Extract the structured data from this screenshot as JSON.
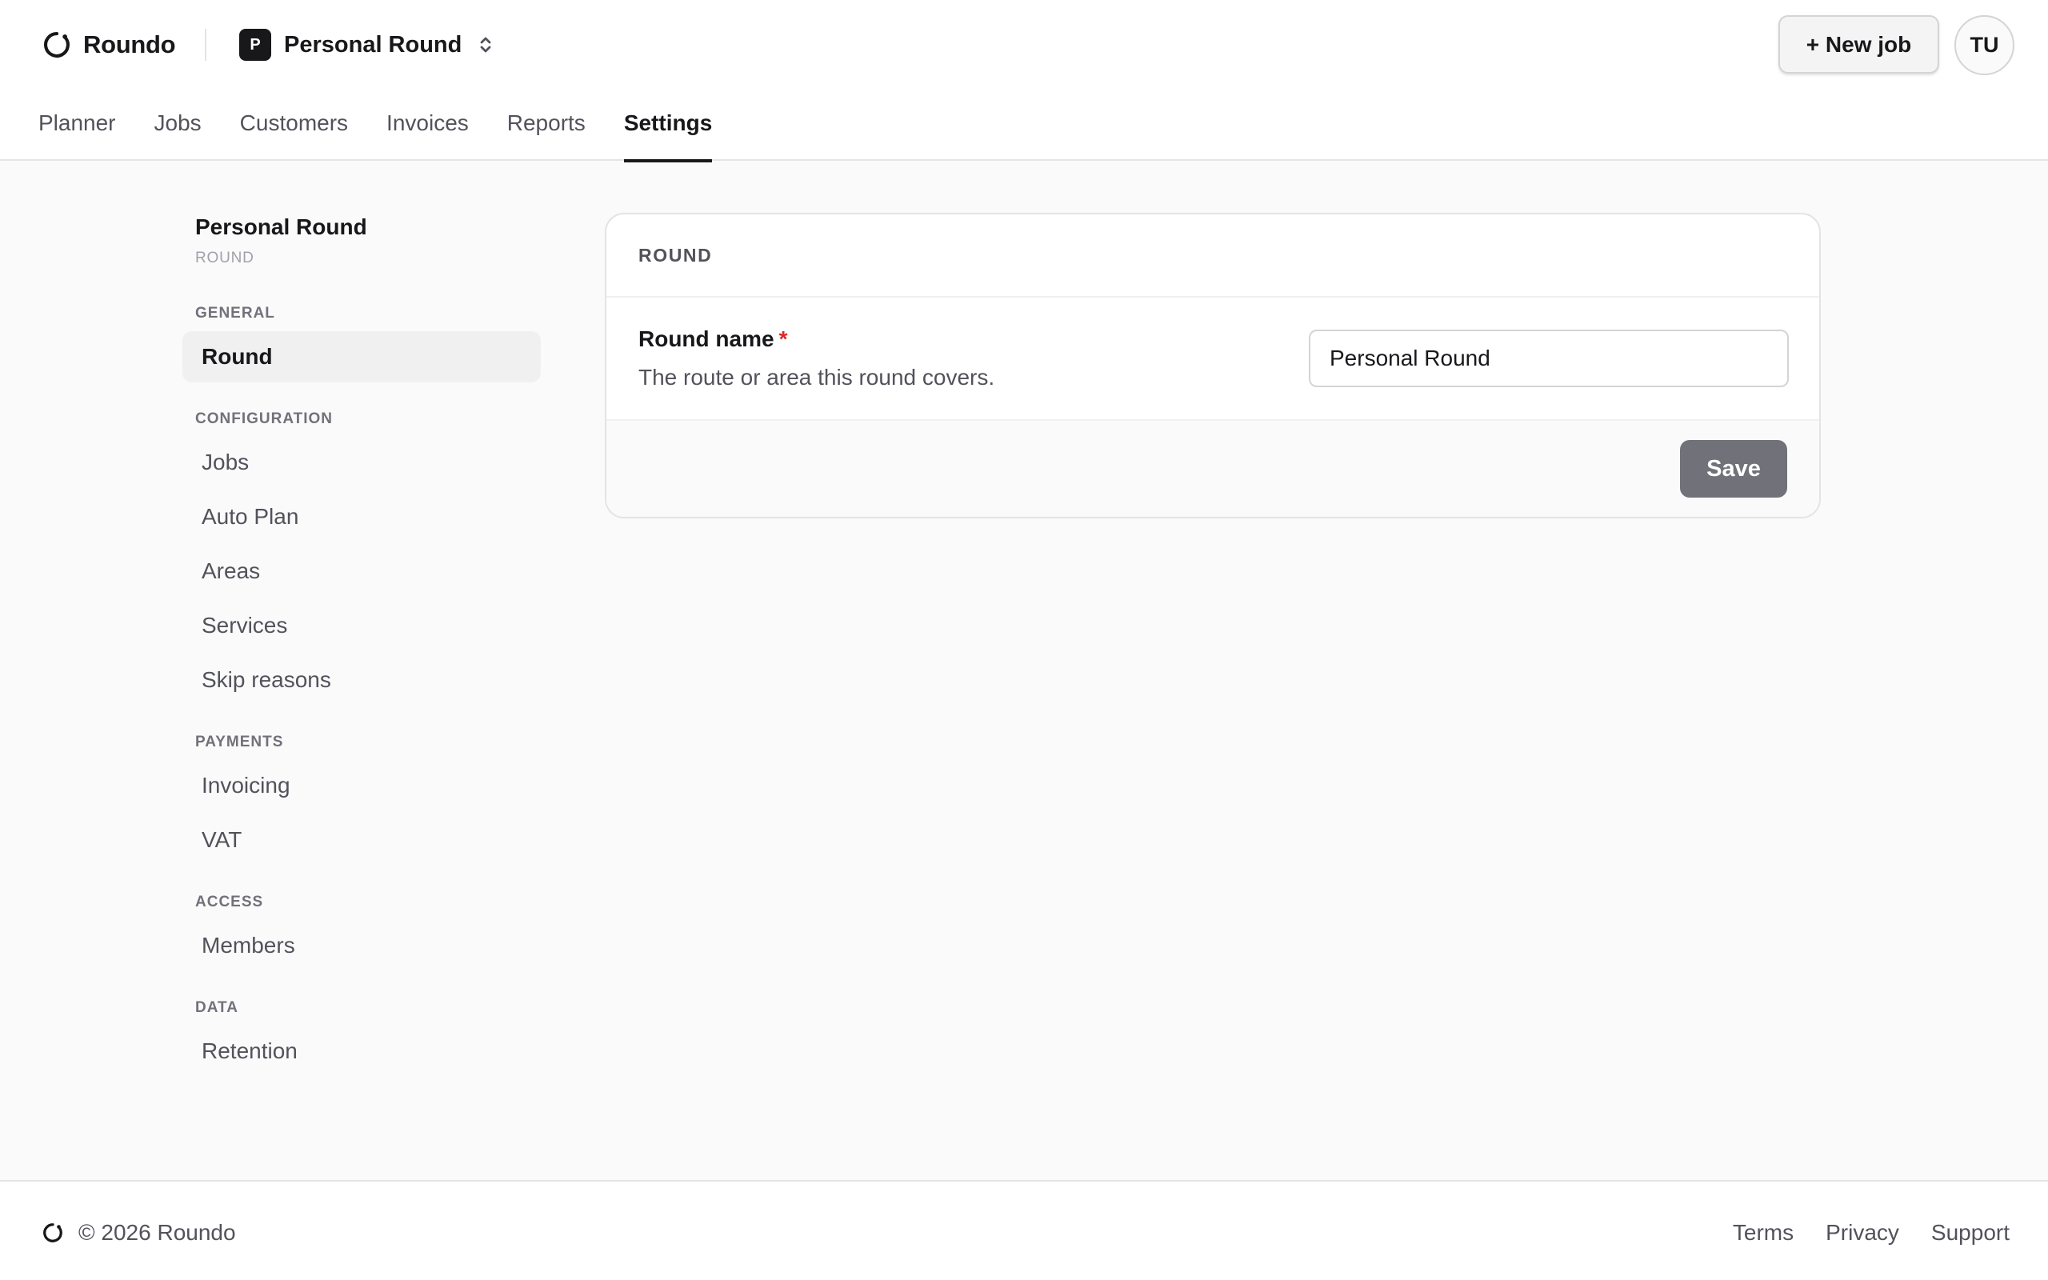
{
  "app": {
    "brand_name": "Roundo",
    "brand_icon": "roundo-logo-icon"
  },
  "header": {
    "round_switcher": {
      "initial": "P",
      "name": "Personal Round",
      "icon": "chevron-updown-icon"
    },
    "new_job_label": "+ New job",
    "user_initials": "TU"
  },
  "nav": {
    "tabs": [
      {
        "label": "Planner",
        "active": false
      },
      {
        "label": "Jobs",
        "active": false
      },
      {
        "label": "Customers",
        "active": false
      },
      {
        "label": "Invoices",
        "active": false
      },
      {
        "label": "Reports",
        "active": false
      },
      {
        "label": "Settings",
        "active": true
      }
    ]
  },
  "sidebar": {
    "title": "Personal Round",
    "subtitle": "ROUND",
    "sections": [
      {
        "label": "GENERAL",
        "items": [
          {
            "label": "Round",
            "active": true
          }
        ]
      },
      {
        "label": "CONFIGURATION",
        "items": [
          {
            "label": "Jobs",
            "active": false
          },
          {
            "label": "Auto Plan",
            "active": false
          },
          {
            "label": "Areas",
            "active": false
          },
          {
            "label": "Services",
            "active": false
          },
          {
            "label": "Skip reasons",
            "active": false
          }
        ]
      },
      {
        "label": "PAYMENTS",
        "items": [
          {
            "label": "Invoicing",
            "active": false
          },
          {
            "label": "VAT",
            "active": false
          }
        ]
      },
      {
        "label": "ACCESS",
        "items": [
          {
            "label": "Members",
            "active": false
          }
        ]
      },
      {
        "label": "DATA",
        "items": [
          {
            "label": "Retention",
            "active": false
          }
        ]
      }
    ]
  },
  "main": {
    "card_title": "ROUND",
    "field": {
      "label": "Round name",
      "required_mark": "*",
      "help": "The route or area this round covers.",
      "value": "Personal Round"
    },
    "save_label": "Save"
  },
  "footer": {
    "copyright": "© 2026 Roundo",
    "links": [
      "Terms",
      "Privacy",
      "Support"
    ]
  },
  "colors": {
    "accent": "#18181b",
    "required": "#dc2626",
    "save_button": "#71717a",
    "background": "#fafafa"
  }
}
